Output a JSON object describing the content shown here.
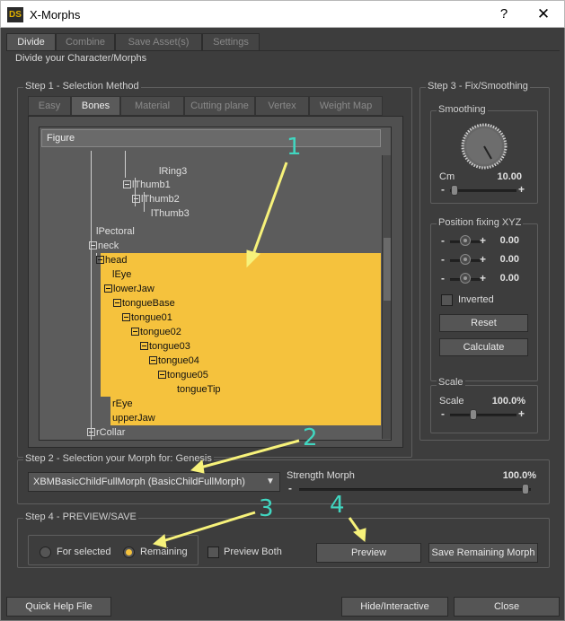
{
  "window": {
    "title": "X-Morphs",
    "app_icon": "DS",
    "help_label": "?",
    "close_label": "✕"
  },
  "tabs": [
    {
      "label": "Divide"
    },
    {
      "label": "Combine"
    },
    {
      "label": "Save Asset(s)"
    },
    {
      "label": "Settings"
    }
  ],
  "section_title": "Divide your Character/Morphs",
  "step1": {
    "label": "Step 1 - Selection Method",
    "tabs": [
      {
        "label": "Easy"
      },
      {
        "label": "Bones"
      },
      {
        "label": "Material"
      },
      {
        "label": "Cutting plane"
      },
      {
        "label": "Vertex"
      },
      {
        "label": "Weight Map"
      }
    ],
    "tree_header": "Figure",
    "nodes": [
      {
        "label": "lRing3"
      },
      {
        "label": "lThumb1"
      },
      {
        "label": "lThumb2"
      },
      {
        "label": "lThumb3"
      },
      {
        "label": "lPectoral"
      },
      {
        "label": "neck"
      },
      {
        "label": "head"
      },
      {
        "label": "lEye"
      },
      {
        "label": "lowerJaw"
      },
      {
        "label": "tongueBase"
      },
      {
        "label": "tongue01"
      },
      {
        "label": "tongue02"
      },
      {
        "label": "tongue03"
      },
      {
        "label": "tongue04"
      },
      {
        "label": "tongue05"
      },
      {
        "label": "tongueTip"
      },
      {
        "label": "rEye"
      },
      {
        "label": "upperJaw"
      },
      {
        "label": "rCollar"
      }
    ]
  },
  "step3": {
    "label": "Step 3 - Fix/Smoothing",
    "smoothing_label": "Smoothing",
    "cm_label": "Cm",
    "cm_value": "10.00",
    "position_label": "Position fixing XYZ",
    "positions": [
      {
        "value": "0.00"
      },
      {
        "value": "0.00"
      },
      {
        "value": "0.00"
      }
    ],
    "inverted_label": "Inverted",
    "reset_label": "Reset",
    "calculate_label": "Calculate",
    "scale_group_label": "Scale",
    "scale_label": "Scale",
    "scale_value": "100.0%"
  },
  "step2": {
    "label": "Step 2 - Selection your Morph for: Genesis",
    "morph_value": "XBMBasicChildFullMorph (BasicChildFullMorph)",
    "strength_label": "Strength Morph",
    "strength_value": "100.0%"
  },
  "step4": {
    "label": "Step 4 - PREVIEW/SAVE",
    "for_selected_label": "For selected",
    "remaining_label": "Remaining",
    "preview_both_label": "Preview Both",
    "preview_label": "Preview",
    "save_label": "Save Remaining Morph"
  },
  "footer": {
    "quick_help_label": "Quick Help File",
    "hide_label": "Hide/Interactive",
    "close_label": "Close"
  },
  "annotations": [
    "1",
    "2",
    "3",
    "4"
  ],
  "colors": {
    "selection": "#f5c23d",
    "annotation": "#41d6c0",
    "arrow": "#f7f27a"
  },
  "minus": "-",
  "plus": "+",
  "dropdown_arrow": "▼"
}
